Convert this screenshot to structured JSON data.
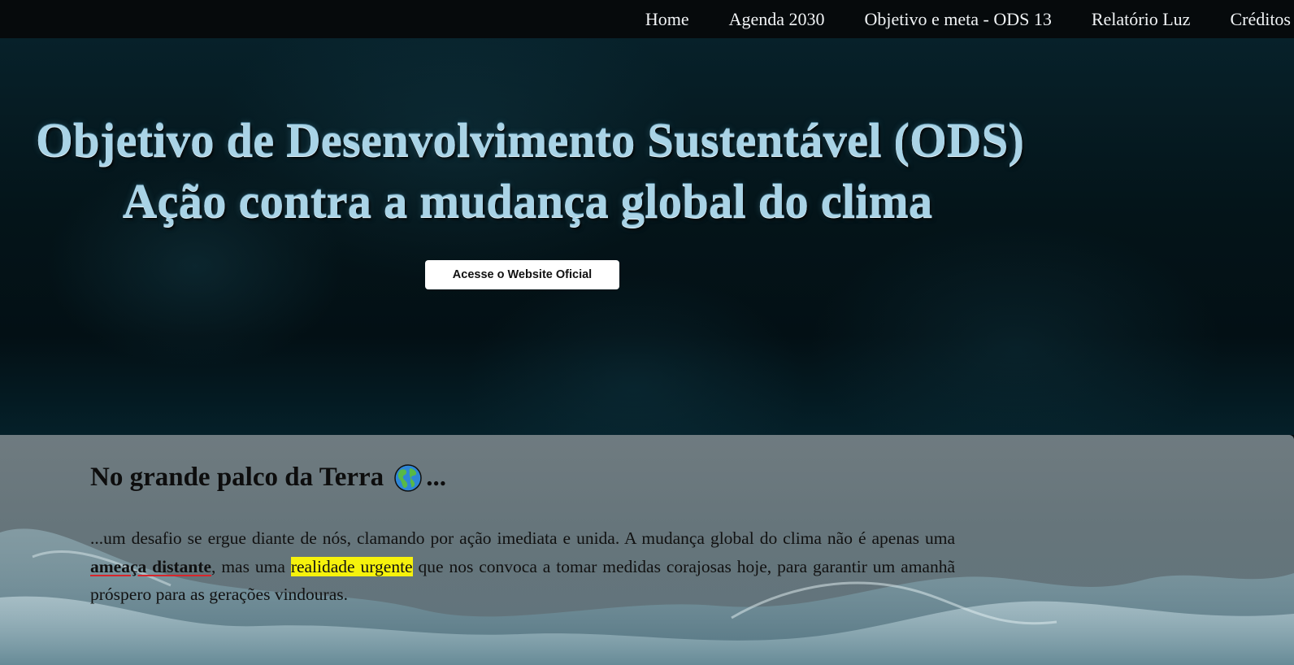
{
  "nav": {
    "items": [
      {
        "label": "Home"
      },
      {
        "label": "Agenda 2030"
      },
      {
        "label": "Objetivo e meta - ODS 13"
      },
      {
        "label": "Relatório Luz"
      },
      {
        "label": "Créditos"
      }
    ]
  },
  "hero": {
    "title_line1": "Objetivo de Desenvolvimento Sustentável (ODS)",
    "title_line2": "Ação contra a mudança global do clima",
    "button_label": "Acesse o Website Oficial"
  },
  "section": {
    "heading": "No grande palco da Terra",
    "heading_suffix": "...",
    "globe_icon": "globe-americas-icon",
    "paragraph": {
      "part1": "...um desafio se ergue diante de nós, clamando por ação imediata e unida. A mudança global do clima não é apenas uma ",
      "threat": "ameaça distante",
      "part2": ", mas uma ",
      "urgent": "realidade urgente",
      "part3": " que nos convoca a tomar medidas corajosas hoje, para garantir um amanhã próspero para as gerações vindouras."
    }
  },
  "colors": {
    "nav_bg": "#060a0c",
    "hero_title": "#a9d3e6",
    "highlight": "#f6f20c",
    "underline": "#d8252a"
  }
}
